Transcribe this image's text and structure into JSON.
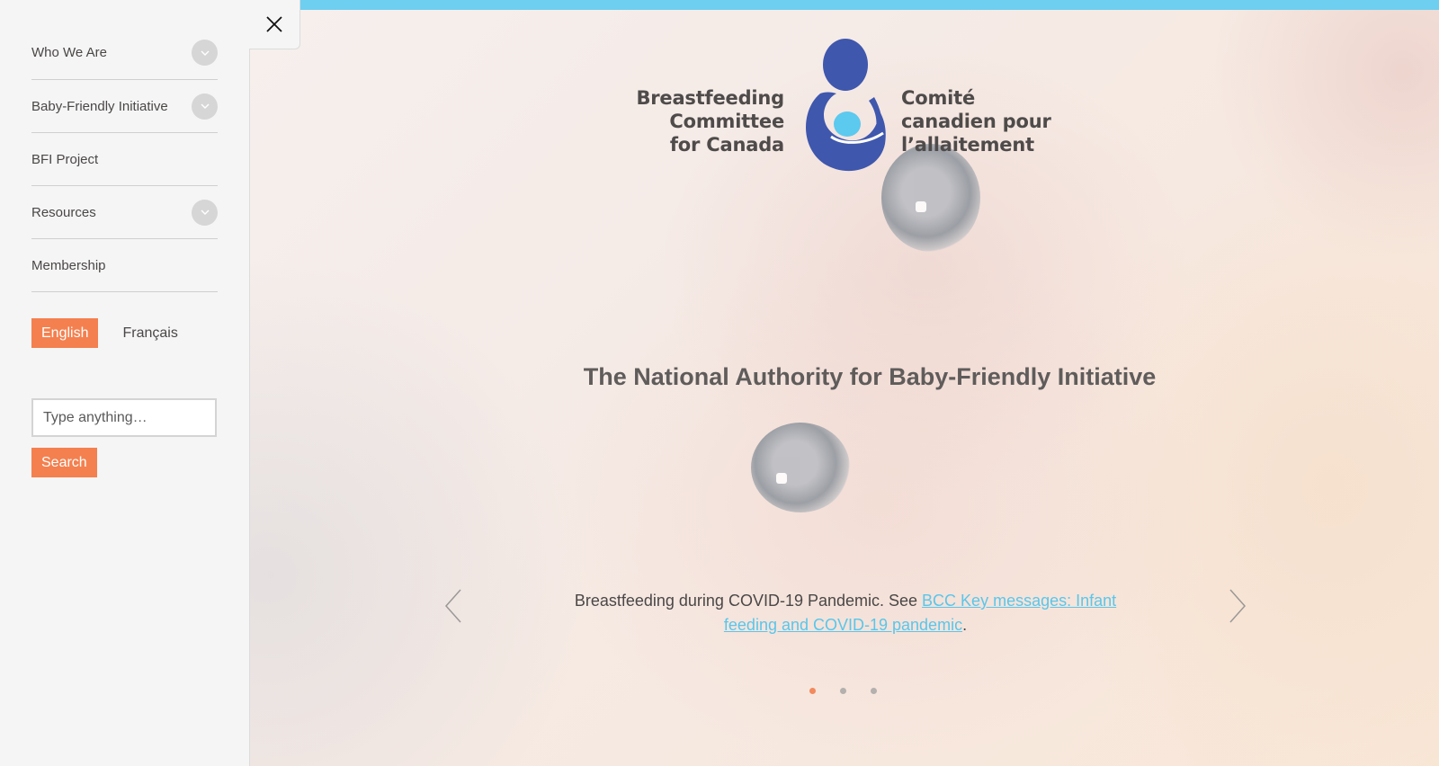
{
  "colors": {
    "accent": "#f4804f",
    "top_bar": "#6ecff0",
    "link": "#5ac6ea",
    "logo_blue": "#3f57ad",
    "logo_light_blue": "#5cc9ef",
    "sidebar_bg": "#f5f5f5"
  },
  "sidebar": {
    "close_icon": "close-icon",
    "nav": [
      {
        "label": "Who We Are",
        "expandable": true
      },
      {
        "label": "Baby-Friendly Initiative",
        "expandable": true
      },
      {
        "label": "BFI Project",
        "expandable": false
      },
      {
        "label": "Resources",
        "expandable": true
      },
      {
        "label": "Membership",
        "expandable": false
      }
    ],
    "language": {
      "active": "English",
      "other": "Français"
    },
    "search": {
      "placeholder": "Type anything…",
      "button_label": "Search"
    }
  },
  "logo": {
    "en_lines": [
      "Breastfeeding",
      "Committee",
      "for Canada"
    ],
    "fr_lines": [
      "Comité",
      "canadien pour",
      "l’allaitement"
    ]
  },
  "hero": {
    "title": "The National Authority for Baby-Friendly Initiative",
    "slide": {
      "text_before": "Breastfeeding during COVID-19 Pandemic. See ",
      "link_text": "BCC Key messages: Infant feeding and COVID-19 pandemic",
      "text_after": "."
    },
    "slides_count": 3,
    "active_slide": 1
  }
}
